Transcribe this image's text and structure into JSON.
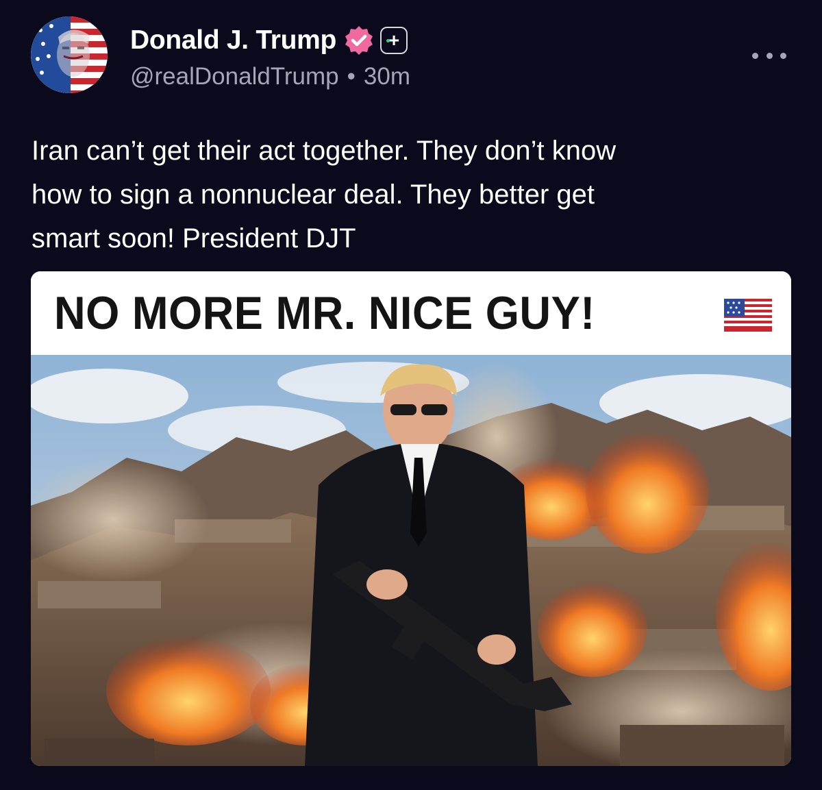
{
  "post": {
    "author": {
      "display_name": "Donald J. Trump",
      "handle": "@realDonaldTrump",
      "verified_icon": "verified-badge-icon",
      "plus_icon": "plus-badge-icon"
    },
    "separator": "•",
    "timestamp": "30m",
    "body": "Iran can’t get their act together. They don’t know\nhow to sign a nonnuclear deal. They better get\nsmart soon! President DJT",
    "media": {
      "banner_text": "NO MORE MR. NICE GUY!",
      "banner_emoji": "us-flag-icon"
    }
  },
  "colors": {
    "background": "#0b0a1c",
    "verified_badge": "#f06aa0",
    "secondary_text": "#a7a6b6"
  }
}
